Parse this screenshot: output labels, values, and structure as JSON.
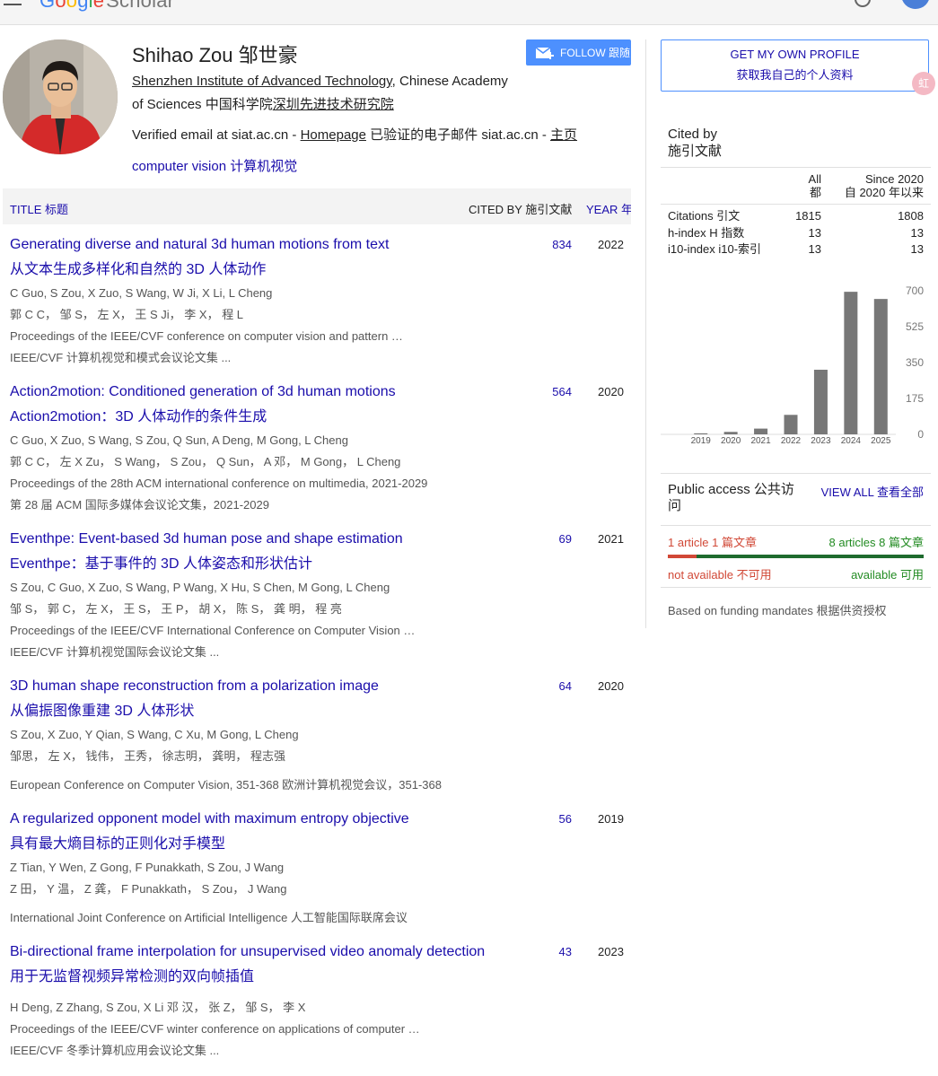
{
  "header": {
    "logo_letters": [
      "G",
      "o",
      "o",
      "g",
      "l",
      "e"
    ],
    "logo_product": "Scholar"
  },
  "profile": {
    "name": "Shihao Zou 邹世豪",
    "affiliation_link": "Shenzhen Institute of Advanced Technology",
    "affiliation_rest": ", Chinese Academy of Sciences 中国科学院",
    "affiliation_link_zh": "深圳先进技术研究院",
    "verified_prefix": "Verified email at siat.ac.cn - ",
    "homepage": "Homepage",
    "verified_zh": " 已验证的电子邮件 siat.ac.cn - ",
    "homepage_zh": "主页",
    "interest": "computer vision 计算机视觉",
    "follow_label": "FOLLOW 跟随"
  },
  "table": {
    "title_header": "TITLE 标题",
    "cited_header": "CITED BY 施引文献",
    "year_header": "YEAR 年份"
  },
  "articles": [
    {
      "title": "Generating diverse and natural 3d human motions from text",
      "title_zh": "从文本生成多样化和自然的 3D 人体动作",
      "authors": "C Guo, S Zou, X Zuo, S Wang, W Ji, X Li, L Cheng",
      "authors_zh": "郭 C C， 邹 S， 左 X， 王 S Ji， 李 X， 程 L",
      "venue": "Proceedings of the IEEE/CVF conference on computer vision and pattern …",
      "venue_zh": "IEEE/CVF 计算机视觉和模式会议论文集 ...",
      "cited": "834",
      "year": "2022"
    },
    {
      "title": "Action2motion: Conditioned generation of 3d human motions",
      "title_zh": "Action2motion：3D 人体动作的条件生成",
      "authors": "C Guo, X Zuo, S Wang, S Zou, Q Sun, A Deng, M Gong, L Cheng",
      "authors_zh": "郭 C C， 左 X Zu， S Wang， S Zou， Q Sun， A 邓， M Gong， L Cheng",
      "venue": "Proceedings of the 28th ACM international conference on multimedia, 2021-2029",
      "venue_zh": "第 28 届 ACM 国际多媒体会议论文集，2021-2029",
      "cited": "564",
      "year": "2020"
    },
    {
      "title": "Eventhpe: Event-based 3d human pose and shape estimation",
      "title_zh": "Eventhpe：基于事件的 3D 人体姿态和形状估计",
      "authors": "S Zou, C Guo, X Zuo, S Wang, P Wang, X Hu, S Chen, M Gong, L Cheng",
      "authors_zh": "邹 S， 郭 C， 左 X， 王 S， 王 P， 胡 X， 陈 S， 龚 明， 程 亮",
      "venue": "Proceedings of the IEEE/CVF International Conference on Computer Vision …",
      "venue_zh": "IEEE/CVF 计算机视觉国际会议论文集 ...",
      "cited": "69",
      "year": "2021"
    },
    {
      "title": "3D human shape reconstruction from a polarization image",
      "title_zh": "从偏振图像重建 3D 人体形状",
      "authors": "S Zou, X Zuo, Y Qian, S Wang, C Xu, M Gong, L Cheng",
      "authors_zh": "邹思， 左 X， 钱伟， 王秀， 徐志明， 龚明， 程志强",
      "venue": "European Conference on Computer Vision, 351-368 欧洲计算机视觉会议，351-368",
      "cited": "64",
      "year": "2020"
    },
    {
      "title": "A regularized opponent model with maximum entropy objective",
      "title_zh": "具有最大熵目标的正则化对手模型",
      "authors": "Z Tian, Y Wen, Z Gong, F Punakkath, S Zou, J Wang",
      "authors_zh": "Z 田， Y 温， Z 龚， F Punakkath， S Zou， J Wang",
      "venue": "International Joint Conference on Artificial Intelligence 人工智能国际联席会议",
      "cited": "56",
      "year": "2019"
    },
    {
      "title": "Bi-directional frame interpolation for unsupervised video anomaly detection",
      "title_zh": "用于无监督视频异常检测的双向帧插值",
      "authors": "H Deng, Z Zhang, S Zou, X Li 邓 汉， 张 Z， 邹 S， 李 X",
      "venue": "Proceedings of the IEEE/CVF winter conference on applications of computer …",
      "venue_zh": "IEEE/CVF 冬季计算机应用会议论文集 ...",
      "cited": "43",
      "year": "2023"
    }
  ],
  "sidebar": {
    "get_profile_en": "GET MY OWN PROFILE",
    "get_profile_zh": "获取我自己的个人资料",
    "ext_icon_label": "虹",
    "cited_by_en": "Cited by",
    "cited_by_zh": "施引文献",
    "col_all_1": "All",
    "col_all_2": "都",
    "col_since_1": "Since 2020",
    "col_since_2": "自 2020 年以来",
    "stats": [
      {
        "label": "Citations 引文",
        "all": "1815",
        "since": "1808"
      },
      {
        "label": "h-index H 指数",
        "all": "13",
        "since": "13"
      },
      {
        "label": "i10-index i10-索引",
        "all": "13",
        "since": "13"
      }
    ],
    "public_access_title": "Public access 公共访问",
    "view_all": "VIEW ALL 查看全部",
    "unavailable_count": "1 article 1 篇文章",
    "available_count": "8 articles 8 篇文章",
    "unavailable_label": "not available 不可用",
    "available_label": "available 可用",
    "mandates": "Based on funding mandates 根据供资授权",
    "colors": {
      "unavailable": "#d14836",
      "available": "#1e6b2e"
    },
    "available_fraction": 0.889
  },
  "chart_data": {
    "type": "bar",
    "categories": [
      "2019",
      "2020",
      "2021",
      "2022",
      "2023",
      "2024",
      "2025"
    ],
    "values": [
      5,
      12,
      28,
      95,
      315,
      695,
      660
    ],
    "ylim": [
      0,
      700
    ],
    "yticks": [
      "700",
      "525",
      "350",
      "175",
      "0"
    ],
    "bar_color": "#777777"
  }
}
